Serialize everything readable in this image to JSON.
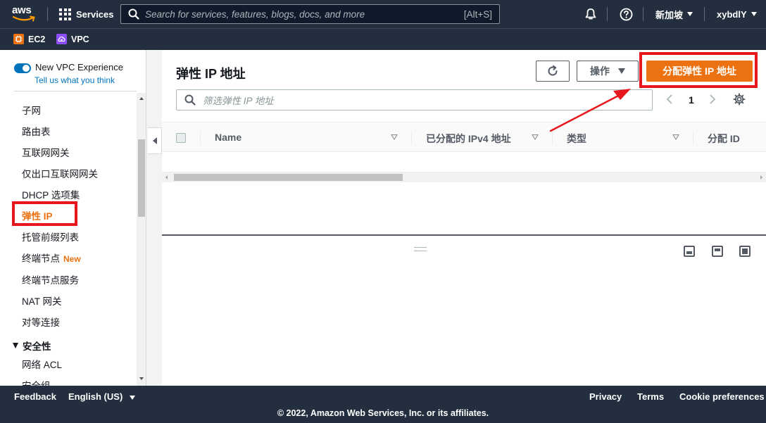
{
  "topnav": {
    "logo_text": "aws",
    "services_label": "Services",
    "search_placeholder": "Search for services, features, blogs, docs, and more",
    "search_shortcut": "[Alt+S]",
    "region": "新加坡",
    "account": "xybdlY"
  },
  "favorites": [
    {
      "label": "EC2",
      "color": "#ec7211",
      "icon": "ec2-icon"
    },
    {
      "label": "VPC",
      "color": "#8c4fff",
      "icon": "vpc-icon"
    }
  ],
  "sidebar": {
    "toggle_label": "New VPC Experience",
    "toggle_link": "Tell us what you think",
    "items": [
      {
        "label": "子网"
      },
      {
        "label": "路由表"
      },
      {
        "label": "互联网网关"
      },
      {
        "label": "仅出口互联网网关"
      },
      {
        "label": "DHCP 选项集"
      },
      {
        "label": "弹性 IP",
        "active": true
      },
      {
        "label": "托管前缀列表"
      },
      {
        "label": "终端节点",
        "badge": "New"
      },
      {
        "label": "终端节点服务"
      },
      {
        "label": "NAT 网关"
      },
      {
        "label": "对等连接"
      }
    ],
    "section_title": "安全性",
    "section_items": [
      {
        "label": "网络 ACL"
      },
      {
        "label": "安全组"
      }
    ]
  },
  "main": {
    "title": "弹性 IP 地址",
    "actions_label": "操作",
    "allocate_label": "分配弹性 IP 地址",
    "filter_placeholder": "筛选弹性 IP 地址",
    "page_number": "1",
    "columns": [
      "Name",
      "已分配的 IPv4 地址",
      "类型",
      "分配 ID"
    ]
  },
  "footer": {
    "feedback": "Feedback",
    "language": "English (US)",
    "privacy": "Privacy",
    "terms": "Terms",
    "cookie": "Cookie preferences",
    "copyright": "© 2022, Amazon Web Services, Inc. or its affiliates."
  },
  "colors": {
    "nav_bg": "#232f3e",
    "accent_orange": "#ec7211",
    "link_blue": "#0073bb",
    "annotation_red": "#e8171e"
  }
}
